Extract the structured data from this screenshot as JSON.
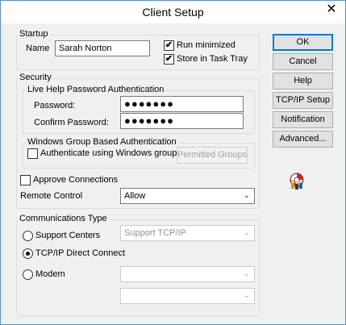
{
  "window": {
    "title": "Client Setup"
  },
  "startup": {
    "group_label": "Startup",
    "name_label": "Name",
    "name_value": "Sarah Norton",
    "run_minimized_label": "Run minimized",
    "run_minimized_checked": true,
    "store_tray_label": "Store in Task Tray",
    "store_tray_checked": true
  },
  "security": {
    "group_label": "Security",
    "live_help": {
      "group_label": "Live Help Password Authentication",
      "password_label": "Password:",
      "password_value": "●●●●●●●",
      "confirm_label": "Confirm Password:",
      "confirm_value": "●●●●●●●"
    },
    "windows_group": {
      "group_label": "Windows Group Based Authentication",
      "auth_windows_label": "Authenticate using Windows groups",
      "auth_windows_checked": false,
      "permitted_groups_label": "Permitted Groups"
    },
    "approve_label": "Approve Connections",
    "approve_checked": false,
    "remote_label": "Remote Control",
    "remote_value": "Allow"
  },
  "comms": {
    "group_label": "Communications Type",
    "support_centers_label": "Support Centers",
    "support_centers_value": "Support TCP/IP",
    "tcpip_label": "TCP/IP Direct Connect",
    "modem_label": "Modem",
    "modem_value_1": "",
    "modem_value_2": "",
    "selected": "tcpip"
  },
  "buttons": {
    "ok": "OK",
    "cancel": "Cancel",
    "help": "Help",
    "tcpip_setup": "TCP/IP Setup",
    "notification": "Notification",
    "advanced": "Advanced..."
  },
  "check_mark": "✔",
  "close_glyph": "✕",
  "caret_glyph": "⌄",
  "icons": {
    "app": "lifebuoy-people-icon"
  }
}
